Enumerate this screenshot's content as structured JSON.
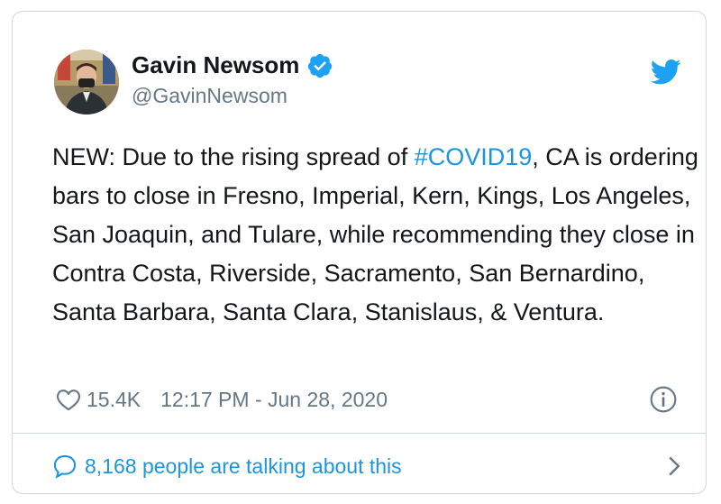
{
  "author": {
    "name": "Gavin Newsom",
    "handle": "@GavinNewsom",
    "verified": true
  },
  "tweet": {
    "text_before": "NEW: Due to the rising spread of ",
    "hashtag": "#COVID19",
    "text_after": ", CA is ordering bars to close in Fresno, Imperial, Kern, Kings, Los Angeles, San Joaquin, and Tulare, while recommending they close in Contra Costa, Riverside, Sacramento, San Bernardino, Santa Barbara, Santa Clara, Stanislaus, & Ventura."
  },
  "meta": {
    "likes": "15.4K",
    "timestamp": "12:17 PM - Jun 28, 2020"
  },
  "footer": {
    "talking": "8,168 people are talking about this"
  },
  "icons": {
    "verified": "verified-badge-icon",
    "brand": "twitter-bird-icon",
    "like": "heart-icon",
    "info": "info-icon",
    "reply": "speech-bubble-icon",
    "more": "chevron-right-icon"
  },
  "colors": {
    "accent": "#1b95e0",
    "text": "#14171a",
    "secondary": "#657786",
    "border": "#cfd9de"
  }
}
